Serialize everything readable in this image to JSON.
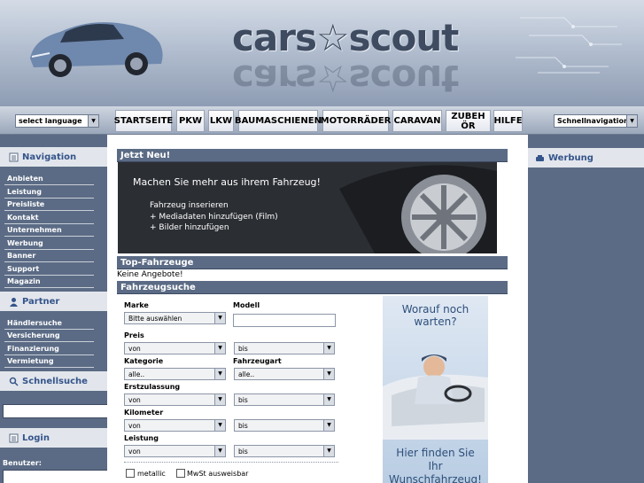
{
  "header": {
    "logo_text": "cars☆scout"
  },
  "language_select": {
    "value": "select language"
  },
  "quick_nav_select": {
    "value": "Schnellnavigation"
  },
  "nav": [
    "STARTSEITE",
    "PKW",
    "LKW",
    "BAUMASCHIENEN",
    "MOTORRÄDER",
    "CARAVAN",
    "ZUBEHÖR",
    "HILFE"
  ],
  "sidebar": {
    "navigation_title": "Navigation",
    "navigation_items": [
      "Anbieten",
      "Leistung",
      "Preisliste",
      "Kontakt",
      "Unternehmen",
      "Werbung",
      "Banner",
      "Support",
      "Magazin"
    ],
    "partner_title": "Partner",
    "partner_items": [
      "Händlersuche",
      "Versicherung",
      "Finanzierung",
      "Vermietung"
    ],
    "quicksearch_title": "Schnellsuche",
    "login_title": "Login",
    "user_label": "Benutzer:"
  },
  "main": {
    "news_title": "Jetzt Neu!",
    "banner": {
      "headline": "Machen Sie mehr aus ihrem Fahrzeug!",
      "line1": "Fahrzeug inserieren",
      "line2": "+ Mediadaten hinzufügen (Film)",
      "line3": "+ Bilder hinzufügen"
    },
    "top_title": "Top-Fahrzeuge",
    "no_offers": "Keine Angebote!",
    "search_title": "Fahrzeugsuche",
    "form": {
      "marke_label": "Marke",
      "marke_value": "Bitte auswählen",
      "modell_label": "Modell",
      "preis_label": "Preis",
      "kategorie_label": "Kategorie",
      "fahrzeugart_label": "Fahrzeugart",
      "erstzulassung_label": "Erstzulassung",
      "kilometer_label": "Kilometer",
      "leistung_label": "Leistung",
      "von": "von",
      "bis": "bis",
      "alle": "alle..",
      "metallic_label": "metallic",
      "mwst_label": "MwSt ausweisbar"
    },
    "ad": {
      "top_text": "Worauf noch warten?",
      "bottom_line1": "Hier finden Sie",
      "bottom_line2": "Ihr Wunschfahrzeug!"
    }
  },
  "right_sidebar": {
    "werbung_title": "Werbung"
  },
  "colors": {
    "sidebar": "#5b6b85",
    "heading": "#35548a",
    "header": "#b3bfd0"
  }
}
